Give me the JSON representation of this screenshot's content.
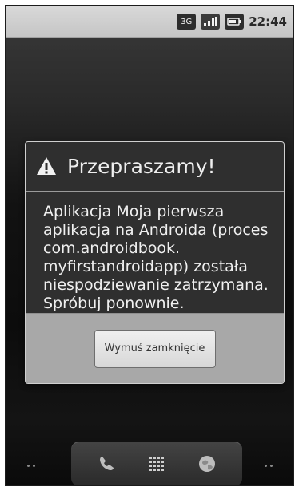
{
  "status_bar": {
    "network": "3G",
    "time": "22:44"
  },
  "dialog": {
    "title": "Przepraszamy!",
    "message_lines": [
      "Aplikacja Moja pierwsza",
      "aplikacja na Androida (proces",
      "com.androidbook.",
      "myfirstandroidapp) została",
      "niespodziewanie zatrzymana.",
      "Spróbuj ponownie."
    ],
    "button_label": "Wymuś zamknięcie"
  },
  "icons": {
    "warning": "warning-icon",
    "network": "network-icon",
    "signal": "signal-icon",
    "battery": "battery-icon",
    "phone": "phone-icon",
    "apps": "apps-grid-icon",
    "browser": "browser-globe-icon",
    "dots": "page-dots-icon"
  },
  "colors": {
    "dialog_body": "#2f2f2f",
    "dialog_footer": "#a8a8a8",
    "status_bar": "#cfcfcf",
    "text_light": "#f0f0f0"
  }
}
